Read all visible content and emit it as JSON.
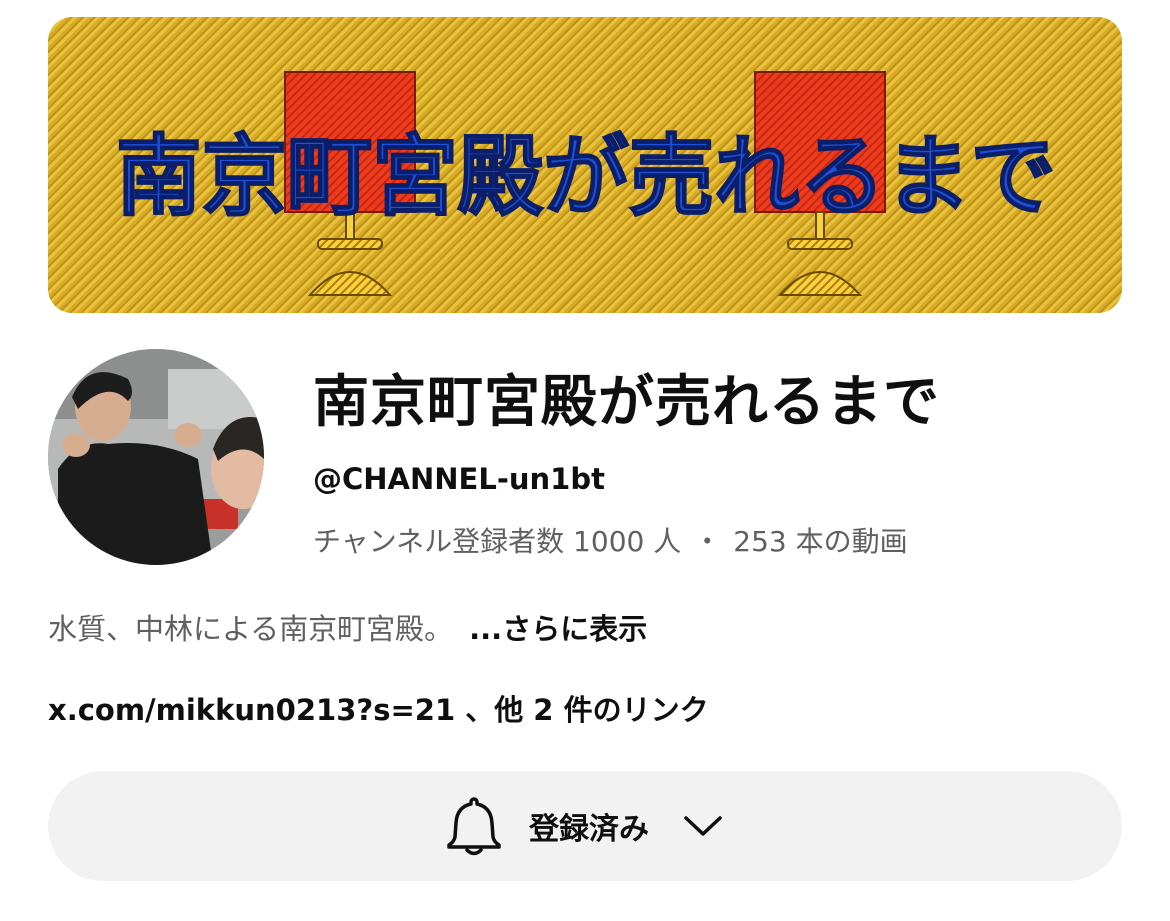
{
  "banner": {
    "title_text": "南京町宮殿が売れるまで",
    "colors": {
      "background": "#e3b72a",
      "text": "#1e4fd6",
      "block": "#f03a1e",
      "lamp": "#f4c21a"
    }
  },
  "avatar": {
    "icon": "channel-avatar-photo"
  },
  "channel": {
    "name": "南京町宮殿が売れるまで",
    "handle": "@CHANNEL-un1bt",
    "subscribers": "チャンネル登録者数 1000 人",
    "separator": "・",
    "videos": "253 本の動画"
  },
  "description": {
    "text": "水質、中林による南京町宮殿。",
    "more_label": "...さらに表示"
  },
  "links": {
    "text": "x.com/mikkun0213?s=21 、他 2 件のリンク"
  },
  "subscribe_button": {
    "label": "登録済み",
    "icon": "bell-icon",
    "dropdown_icon": "chevron-down-icon",
    "background": "#f2f2f2"
  }
}
